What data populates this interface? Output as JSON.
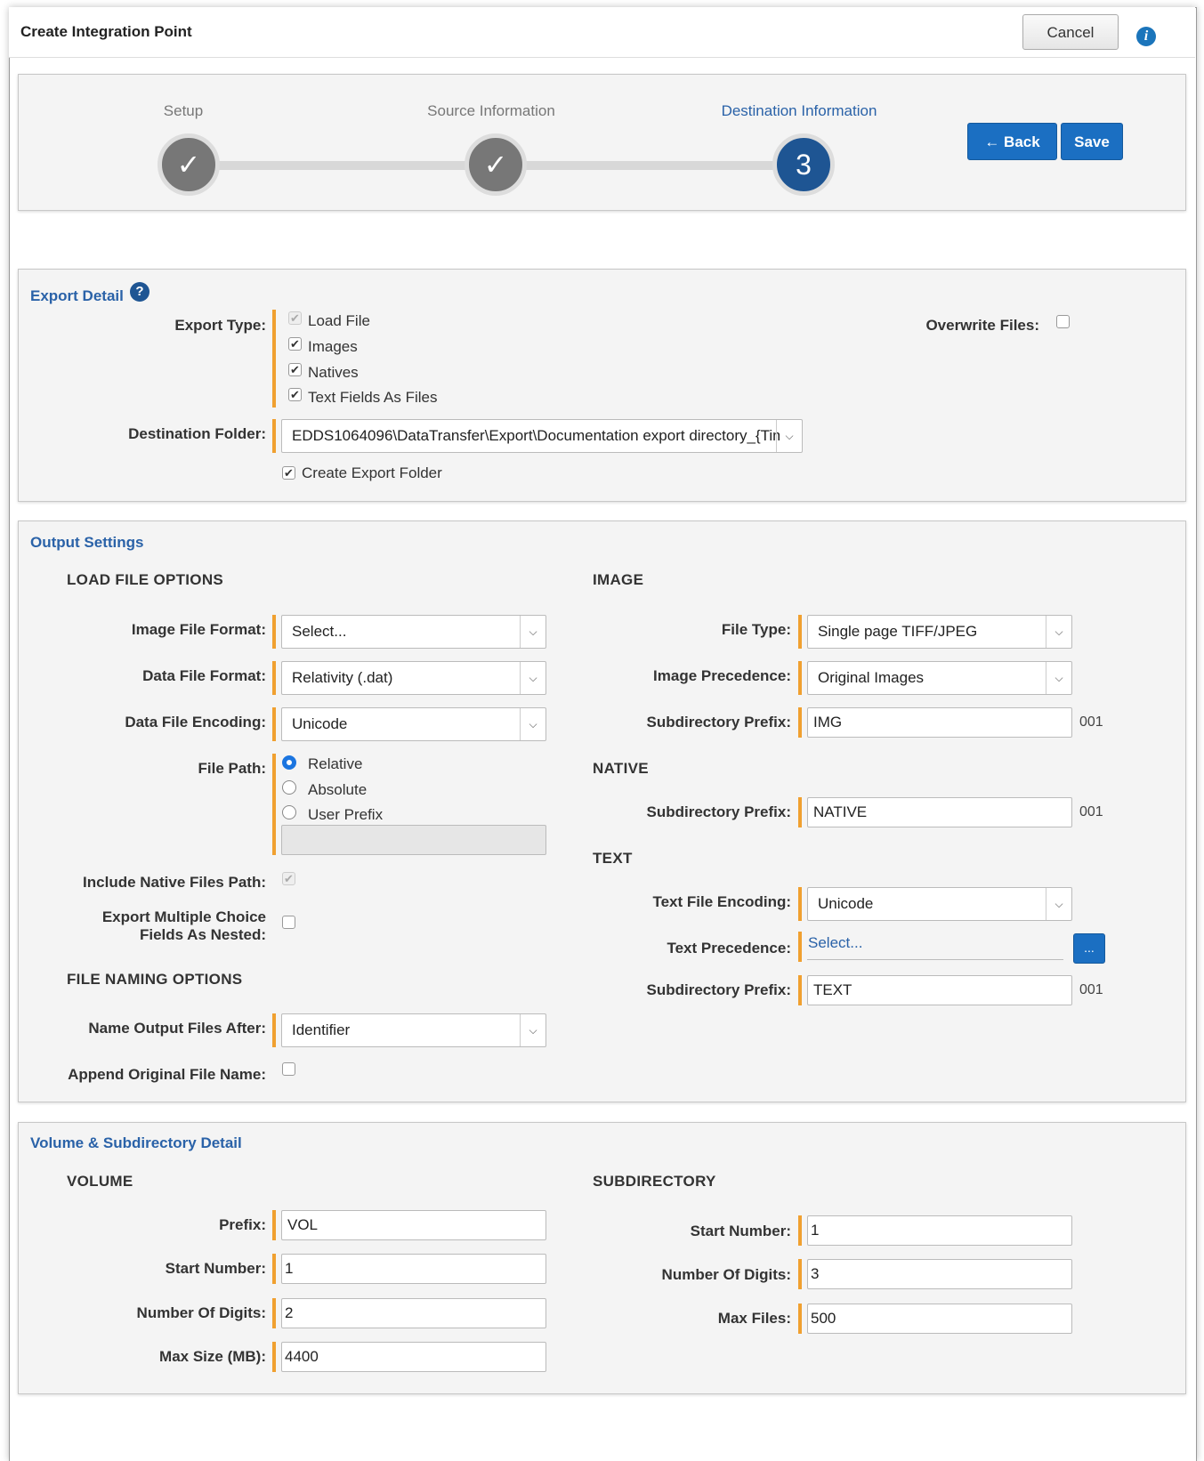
{
  "header": {
    "title": "Create Integration Point",
    "cancel_label": "Cancel",
    "info_icon": "i"
  },
  "wizard": {
    "steps": [
      {
        "label": "Setup",
        "state": "done",
        "glyph": "✓"
      },
      {
        "label": "Source Information",
        "state": "done",
        "glyph": "✓"
      },
      {
        "label": "Destination Information",
        "state": "current",
        "glyph": "3"
      }
    ],
    "back_label": "← Back",
    "save_label": "Save"
  },
  "export_detail": {
    "title": "Export Detail",
    "help_icon": "?",
    "export_type_label": "Export Type:",
    "export_types": [
      {
        "label": "Load File",
        "checked": true,
        "disabled": true
      },
      {
        "label": "Images",
        "checked": true
      },
      {
        "label": "Natives",
        "checked": true
      },
      {
        "label": "Text Fields As Files",
        "checked": true
      }
    ],
    "overwrite_label": "Overwrite Files:",
    "destination_label": "Destination Folder:",
    "destination_value": "EDDS1064096\\DataTransfer\\Export\\Documentation export directory_{Tim",
    "create_folder_label": "Create Export Folder"
  },
  "output_settings": {
    "title": "Output Settings",
    "load_file_heading": "LOAD FILE OPTIONS",
    "image_file_format_label": "Image File Format:",
    "image_file_format_value": "Select...",
    "data_file_format_label": "Data File Format:",
    "data_file_format_value": "Relativity (.dat)",
    "data_file_encoding_label": "Data File Encoding:",
    "data_file_encoding_value": "Unicode",
    "file_path_label": "File Path:",
    "file_path_options": [
      "Relative",
      "Absolute",
      "User Prefix"
    ],
    "include_native_label": "Include Native Files Path:",
    "export_multiple_label_1": "Export Multiple Choice",
    "export_multiple_label_2": "Fields As Nested:",
    "file_naming_heading": "FILE NAMING OPTIONS",
    "name_output_label": "Name Output Files After:",
    "name_output_value": "Identifier",
    "append_original_label": "Append Original File Name:",
    "image_heading": "IMAGE",
    "file_type_label": "File Type:",
    "file_type_value": "Single page TIFF/JPEG",
    "image_precedence_label": "Image Precedence:",
    "image_precedence_value": "Original Images",
    "image_subdir_label": "Subdirectory Prefix:",
    "image_subdir_value": "IMG",
    "image_subdir_suffix": "001",
    "native_heading": "NATIVE",
    "native_subdir_label": "Subdirectory Prefix:",
    "native_subdir_value": "NATIVE",
    "native_subdir_suffix": "001",
    "text_heading": "TEXT",
    "text_encoding_label": "Text File Encoding:",
    "text_encoding_value": "Unicode",
    "text_precedence_label": "Text Precedence:",
    "text_precedence_value": "Select...",
    "text_precedence_button": "...",
    "text_subdir_label": "Subdirectory Prefix:",
    "text_subdir_value": "TEXT",
    "text_subdir_suffix": "001"
  },
  "volume_detail": {
    "title": "Volume & Subdirectory Detail",
    "volume_heading": "VOLUME",
    "prefix_label": "Prefix:",
    "prefix_value": "VOL",
    "vol_start_label": "Start Number:",
    "vol_start_value": "1",
    "vol_digits_label": "Number Of Digits:",
    "vol_digits_value": "2",
    "max_size_label": "Max Size (MB):",
    "max_size_value": "4400",
    "subdir_heading": "SUBDIRECTORY",
    "sub_start_label": "Start Number:",
    "sub_start_value": "1",
    "sub_digits_label": "Number Of Digits:",
    "sub_digits_value": "3",
    "max_files_label": "Max Files:",
    "max_files_value": "500"
  },
  "colors": {
    "accent_blue": "#1b6fc2",
    "required_marker": "#f0a030",
    "link_blue": "#2a62a8"
  }
}
